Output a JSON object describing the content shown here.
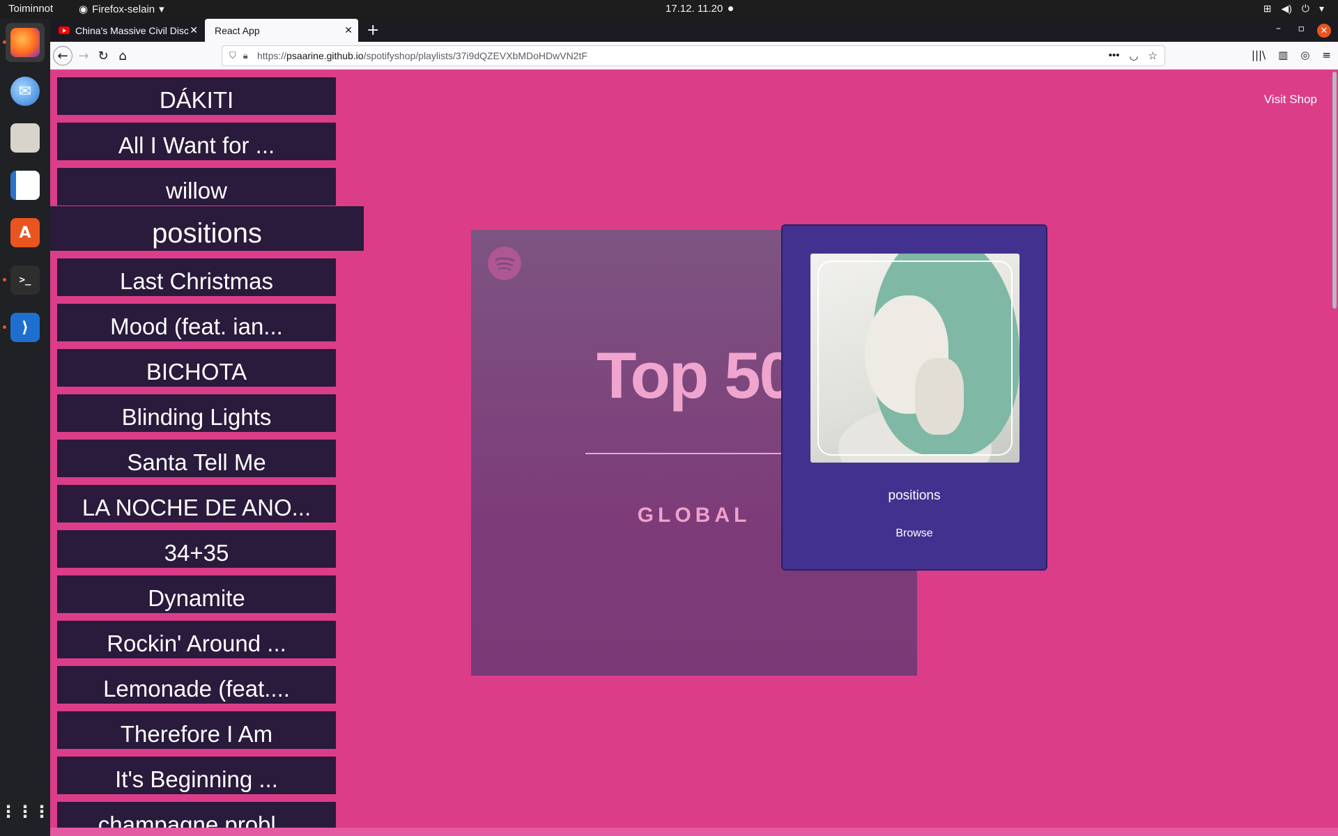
{
  "topbar": {
    "activities": "Toiminnot",
    "app_menu": "Firefox-selain",
    "clock": "17.12.  11.20"
  },
  "dock": {
    "items": [
      {
        "name": "firefox",
        "icon": "firefox-icon"
      },
      {
        "name": "thunderbird",
        "icon": "mail-icon"
      },
      {
        "name": "files",
        "icon": "folder-icon"
      },
      {
        "name": "writer",
        "icon": "document-icon"
      },
      {
        "name": "software",
        "icon": "app-store-icon"
      },
      {
        "name": "terminal",
        "icon": "terminal-icon"
      },
      {
        "name": "vscode",
        "icon": "vscode-icon"
      }
    ],
    "apps_grid": "show-apps-icon"
  },
  "browser": {
    "tabs": [
      {
        "title": "China's Massive Civil Disc",
        "active": false
      },
      {
        "title": "React App",
        "active": true
      }
    ],
    "url_host": "psaarine.github.io",
    "url_prefix": "https://",
    "url_path": "/spotifyshop/playlists/37i9dQZEVXbMDoHDwVN2tF"
  },
  "page": {
    "visit_shop": "Visit Shop",
    "tracks": [
      "DÁKITI",
      "All I Want for ...",
      "willow",
      "positions",
      "Last Christmas",
      "Mood (feat. ian...",
      "BICHOTA",
      "Blinding Lights",
      "Santa Tell Me",
      "LA NOCHE DE ANO...",
      "34+35",
      "Dynamite",
      "Rockin' Around ...",
      "Lemonade (feat....",
      "Therefore I Am",
      "It's Beginning ...",
      "champagne probl..."
    ],
    "selected_index": 3,
    "cover": {
      "headline": "Top 50",
      "subtitle": "GLOBAL"
    },
    "card": {
      "title": "positions",
      "button": "Browse"
    }
  },
  "colors": {
    "page_bg": "#dc3d89",
    "track_bg": "#2a1a3c",
    "card_bg": "#43318f"
  }
}
